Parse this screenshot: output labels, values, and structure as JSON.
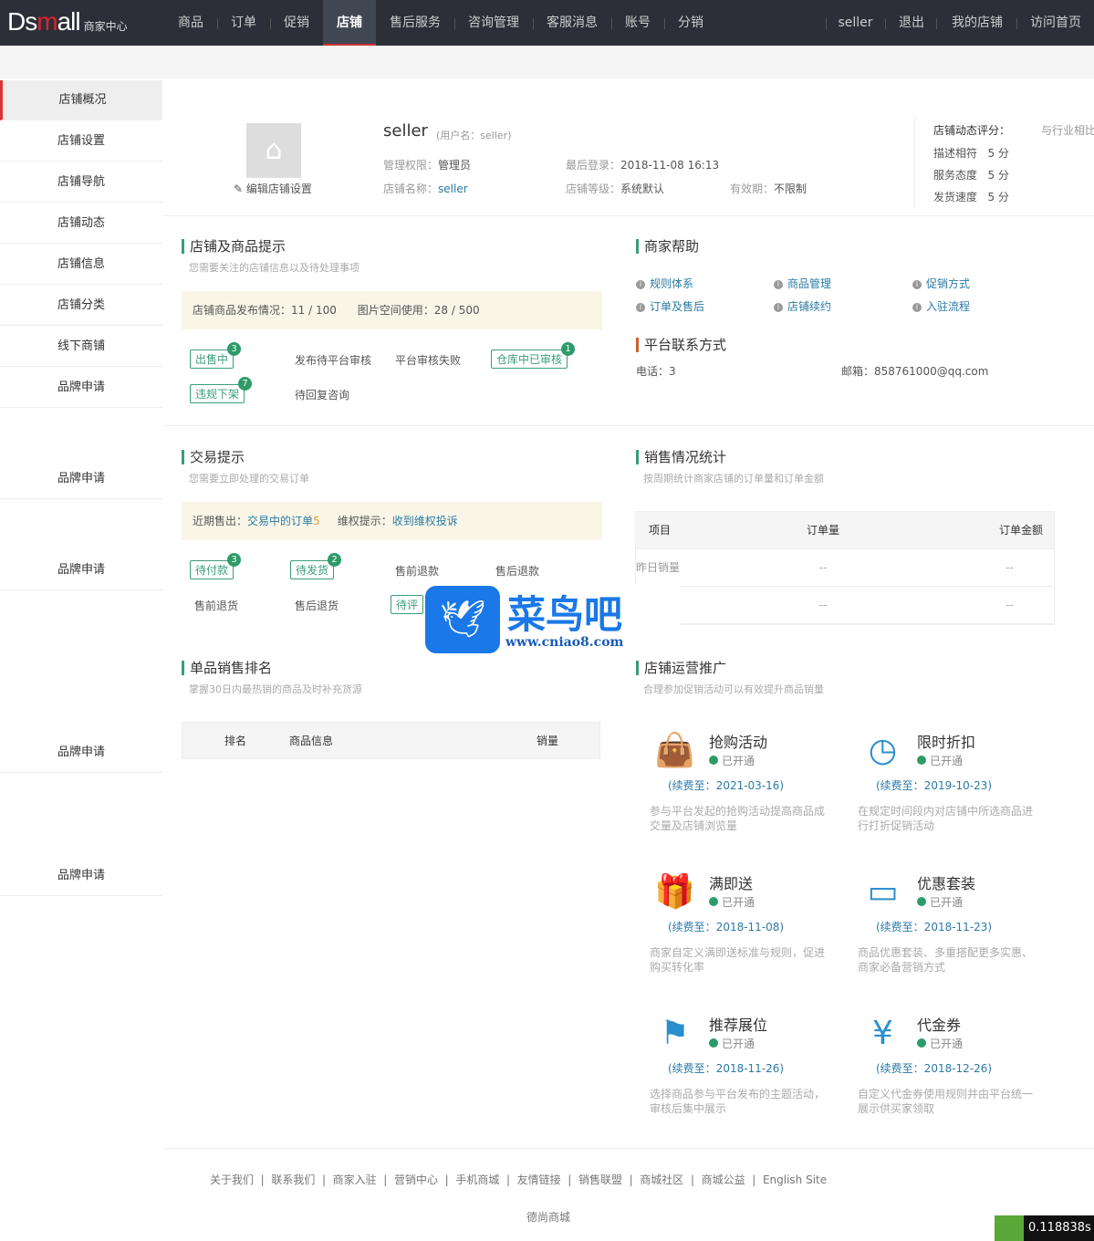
{
  "header": {
    "logo": "Dsmall",
    "logo_sub": "商家中心",
    "nav": [
      "商品",
      "订单",
      "促销",
      "店铺",
      "售后服务",
      "咨询管理",
      "客服消息",
      "账号",
      "分销"
    ],
    "active_nav": "店铺",
    "right": [
      "seller",
      "退出",
      "我的店铺",
      "访问首页"
    ]
  },
  "sidebar": {
    "items": [
      "店铺概况",
      "店铺设置",
      "店铺导航",
      "店铺动态",
      "店铺信息",
      "店铺分类",
      "线下商铺",
      "品牌申请",
      "品牌申请",
      "品牌申请",
      "品牌申请",
      "品牌申请"
    ]
  },
  "profile": {
    "name": "seller",
    "username": "(用户名：seller)",
    "edit": "编辑店铺设置",
    "role_label": "管理权限：",
    "role": "管理员",
    "last_login_label": "最后登录：",
    "last_login": "2018-11-08 16:13",
    "store_label": "店铺名称：",
    "store": "seller",
    "grade_label": "店铺等级：",
    "grade": "系统默认",
    "expire_label": "有效期：",
    "expire": "不限制"
  },
  "rating": {
    "title": "店铺动态评分：",
    "compare": "与行业相比",
    "items": [
      {
        "label": "描述相符",
        "value": "5 分"
      },
      {
        "label": "服务态度",
        "value": "5 分"
      },
      {
        "label": "发货速度",
        "value": "5 分"
      }
    ]
  },
  "store_tips": {
    "title": "店铺及商品提示",
    "sub": "您需要关注的店铺信息以及待处理事项",
    "bar1": "店铺商品发布情况：11 /  100",
    "bar2": "图片空间使用：28 / 500",
    "tags": [
      {
        "label": "出售中",
        "count": "3"
      },
      {
        "label": "发布待平台审核"
      },
      {
        "label": "平台审核失败"
      },
      {
        "label": "仓库中已审核",
        "count": "1"
      },
      {
        "label": "违规下架",
        "count": "7"
      },
      {
        "label": "待回复咨询"
      }
    ]
  },
  "help": {
    "title": "商家帮助",
    "links": [
      "规则体系",
      "商品管理",
      "促销方式",
      "订单及售后",
      "店铺续约",
      "入驻流程"
    ]
  },
  "contact": {
    "title": "平台联系方式",
    "phone": "电话：3",
    "email": "邮箱：858761000@qq.com"
  },
  "trade": {
    "title": "交易提示",
    "sub": "您需要立即处理的交易订单",
    "recent_label": "近期售出：",
    "recent_link": "交易中的订单",
    "recent_count": "5",
    "rights_label": "维权提示：",
    "rights_link": "收到维权投诉",
    "tags": [
      {
        "label": "待付款",
        "count": "3"
      },
      {
        "label": "待发货",
        "count": "2"
      },
      {
        "label": "售前退款"
      },
      {
        "label": "售后退款"
      },
      {
        "label": "售前退货"
      },
      {
        "label": "售后退货"
      },
      {
        "label": "待评"
      }
    ]
  },
  "sales": {
    "title": "销售情况统计",
    "sub": "按周期统计商家店铺的订单量和订单金额",
    "headers": [
      "项目",
      "订单量",
      "订单金额"
    ],
    "rows": [
      [
        "昨日销量",
        "--",
        "--"
      ],
      [
        "",
        "--",
        "--"
      ]
    ]
  },
  "rank": {
    "title": "单品销售排名",
    "sub": "掌握30日内最热销的商品及时补充货源",
    "headers": [
      "排名",
      "商品信息",
      "销量"
    ]
  },
  "promo": {
    "title": "店铺运营推广",
    "sub": "合理参加促销活动可以有效提升商品销量",
    "items": [
      {
        "icon": "shopping-bag",
        "title": "抢购活动",
        "status": "已开通",
        "date": "(续费至：2021-03-16)",
        "desc": "参与平台发起的抢购活动提高商品成交量及店铺浏览量"
      },
      {
        "icon": "clock",
        "title": "限时折扣",
        "status": "已开通",
        "date": "(续费至：2019-10-23)",
        "desc": "在规定时间段内对店铺中所选商品进行打折促销活动"
      },
      {
        "icon": "gift",
        "title": "满即送",
        "status": "已开通",
        "date": "(续费至：2018-11-08)",
        "desc": "商家自定义满即送标准与规则，促进购买转化率"
      },
      {
        "icon": "discover-card",
        "title": "优惠套装",
        "status": "已开通",
        "date": "(续费至：2018-11-23)",
        "desc": "商品优惠套装、多重搭配更多实惠、商家必备营销方式"
      },
      {
        "icon": "flag",
        "title": "推荐展位",
        "status": "已开通",
        "date": "(续费至：2018-11-26)",
        "desc": "选择商品参与平台发布的主题活动，审核后集中展示"
      },
      {
        "icon": "yen",
        "title": "代金券",
        "status": "已开通",
        "date": "(续费至：2018-12-26)",
        "desc": "自定义代金券使用规则并由平台统一展示供买家领取"
      }
    ]
  },
  "footer": {
    "links": [
      "关于我们",
      "联系我们",
      "商家入驻",
      "营销中心",
      "手机商城",
      "友情链接",
      "销售联盟",
      "商城社区",
      "商城公益",
      "English Site"
    ],
    "copyright": "德尚商城"
  },
  "watermark": {
    "text": "菜鸟吧",
    "url": "www.cniao8.com"
  },
  "timer": "0.118838s"
}
